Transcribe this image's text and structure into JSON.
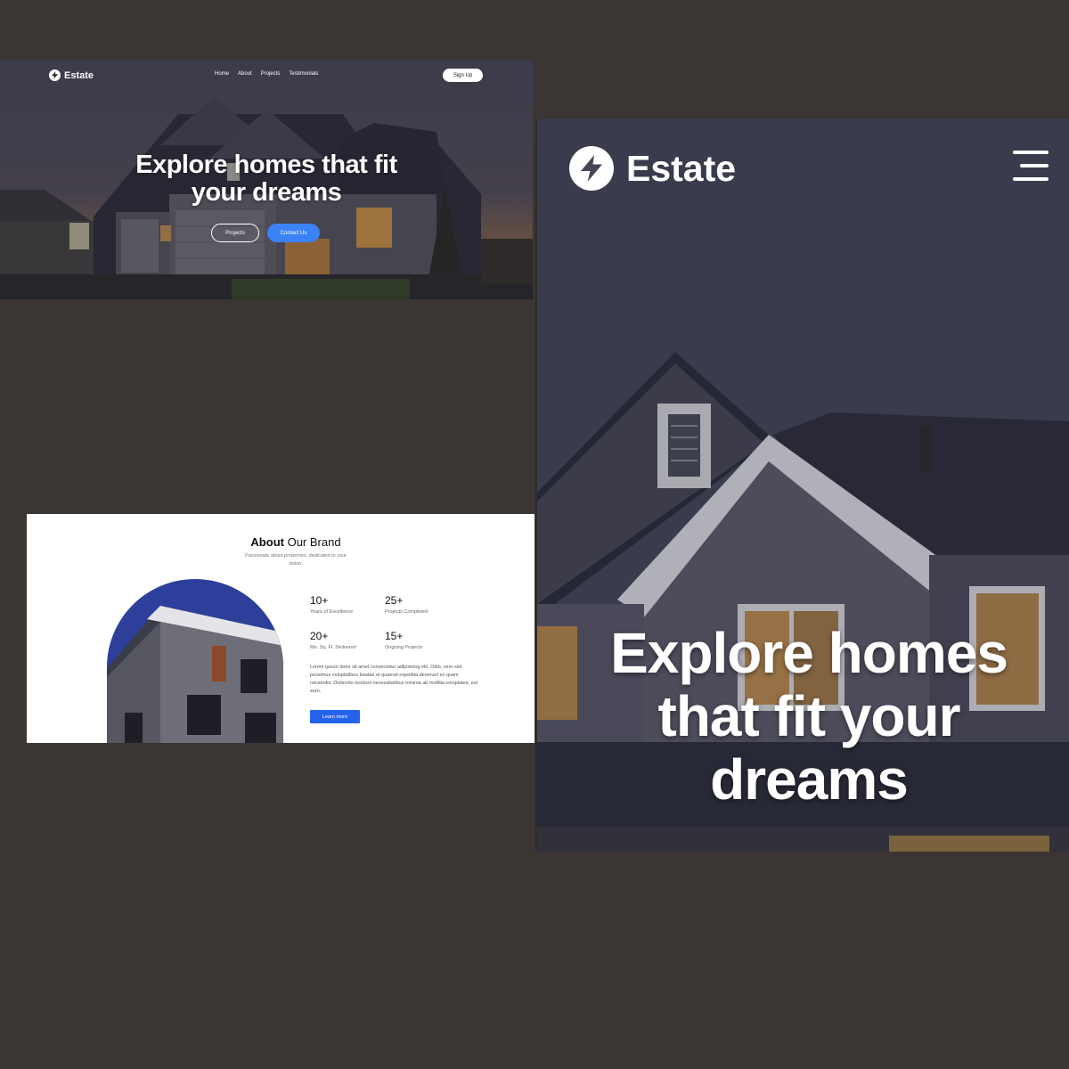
{
  "desktop": {
    "brand": "Estate",
    "nav": [
      "Home",
      "About",
      "Projects",
      "Testimonials"
    ],
    "signup_label": "Sign Up",
    "hero_title": "Explore homes that fit your dreams",
    "projects_label": "Projects",
    "contact_label": "Contact Us"
  },
  "about": {
    "title_bold": "About",
    "title_rest": " Our Brand",
    "subtitle": "Passionate about properties, dedicated to your vision.",
    "stats": [
      {
        "value": "10+",
        "label": "Years of Excellence"
      },
      {
        "value": "25+",
        "label": "Projects Completed"
      },
      {
        "value": "20+",
        "label": "Mn. Sq. Ft. Delivered"
      },
      {
        "value": "15+",
        "label": "Ongoing Projects"
      }
    ],
    "paragraph": "Lorem ipsum dolor sit amet consectetur adipisicing elit. Odio, vero sint possimus voluptatibus beatae et quaerat expedita deserunt ex quam reiciendis. Distinctio incidunt necessitatibus minima ab mollitia voluptates, est eum.",
    "button_label": "Learn more"
  },
  "mobile": {
    "brand": "Estate",
    "hero_title": "Explore homes that fit your dreams"
  },
  "icons": {
    "logo": "bolt-icon",
    "menu": "hamburger-menu-icon"
  },
  "colors": {
    "background": "#3b3533",
    "accent": "#3b82f6",
    "learn_more": "#2563eb"
  }
}
